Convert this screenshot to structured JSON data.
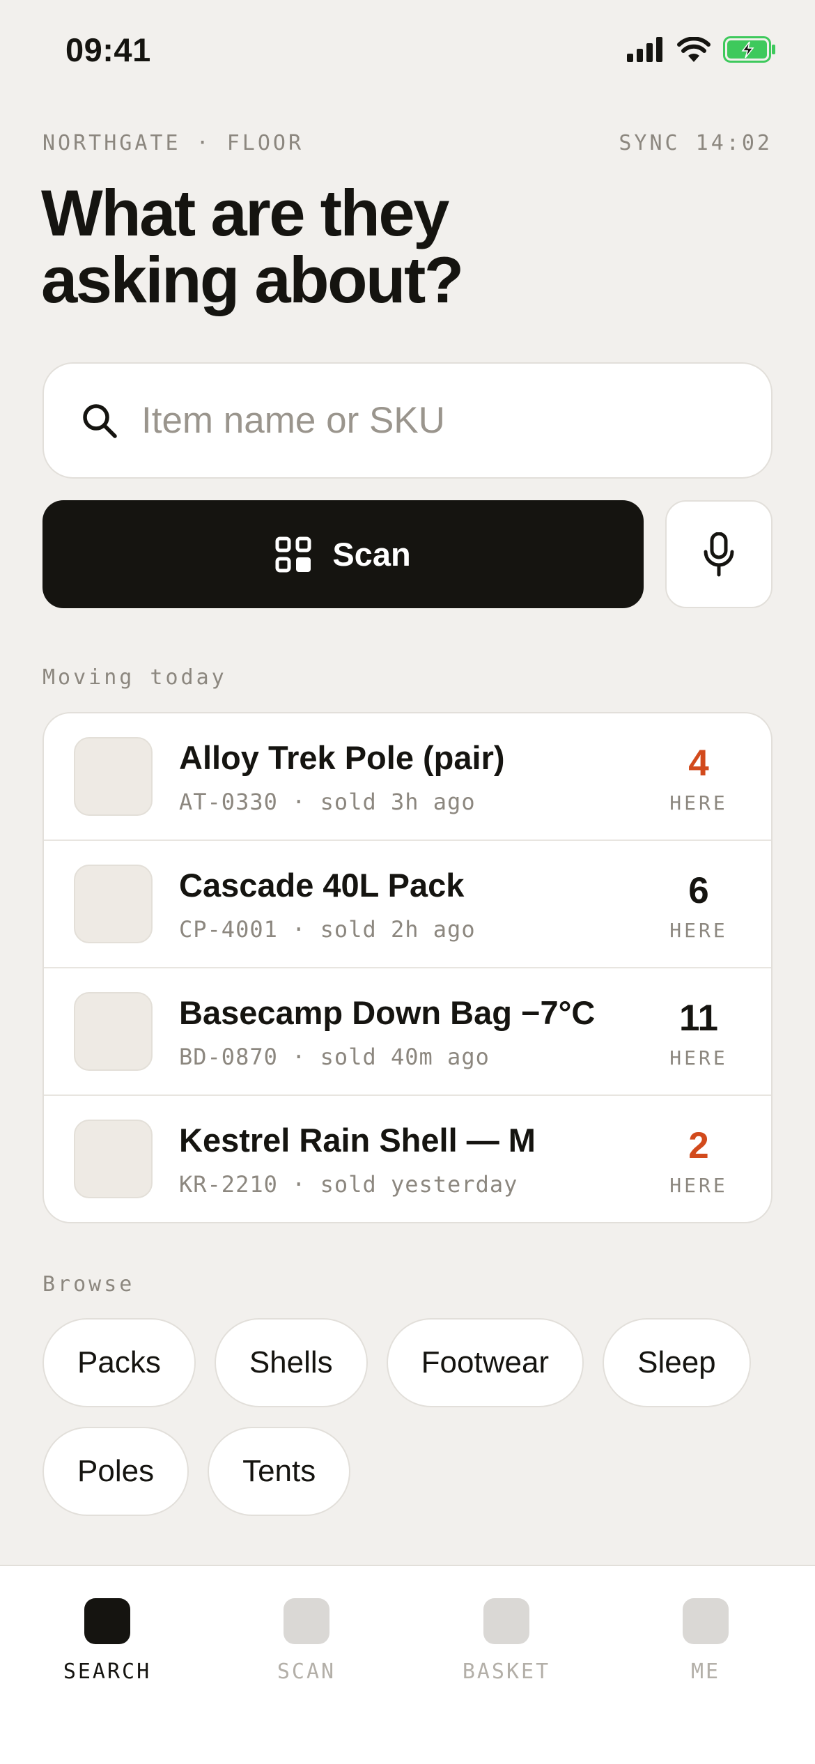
{
  "status_bar": {
    "time": "09:41",
    "icons": [
      "cellular-signal-icon",
      "wifi-icon",
      "battery-charging-icon"
    ],
    "battery_color": "#3EC95C"
  },
  "header": {
    "location": "NORTHGATE · FLOOR",
    "sync": "SYNC 14:02",
    "title_line1": "What are they",
    "title_line2": "asking about?"
  },
  "search": {
    "placeholder": "Item name or SKU",
    "value": "",
    "icon": "search-icon"
  },
  "actions": {
    "scan_label": "Scan",
    "scan_icon": "qr-scan-icon",
    "mic_icon": "microphone-icon"
  },
  "moving_today": {
    "label": "Moving today",
    "items": [
      {
        "name": "Alloy Trek Pole (pair)",
        "meta": "AT-0330 · sold 3h ago",
        "count": "4",
        "count_label": "HERE",
        "low": true
      },
      {
        "name": "Cascade 40L Pack",
        "meta": "CP-4001 · sold 2h ago",
        "count": "6",
        "count_label": "HERE",
        "low": false
      },
      {
        "name": "Basecamp Down Bag −7°C",
        "meta": "BD-0870 · sold 40m ago",
        "count": "11",
        "count_label": "HERE",
        "low": false
      },
      {
        "name": "Kestrel Rain Shell — M",
        "meta": "KR-2210 · sold yesterday",
        "count": "2",
        "count_label": "HERE",
        "low": true
      }
    ]
  },
  "browse": {
    "label": "Browse",
    "chips": [
      "Packs",
      "Shells",
      "Footwear",
      "Sleep",
      "Poles",
      "Tents"
    ]
  },
  "tab_bar": {
    "tabs": [
      {
        "label": "SEARCH",
        "active": true
      },
      {
        "label": "SCAN",
        "active": false
      },
      {
        "label": "BASKET",
        "active": false
      },
      {
        "label": "ME",
        "active": false
      }
    ]
  },
  "colors": {
    "background": "#F2F0ED",
    "ink": "#151410",
    "accent_low_stock": "#D24A1C",
    "muted": "#8C877F"
  }
}
